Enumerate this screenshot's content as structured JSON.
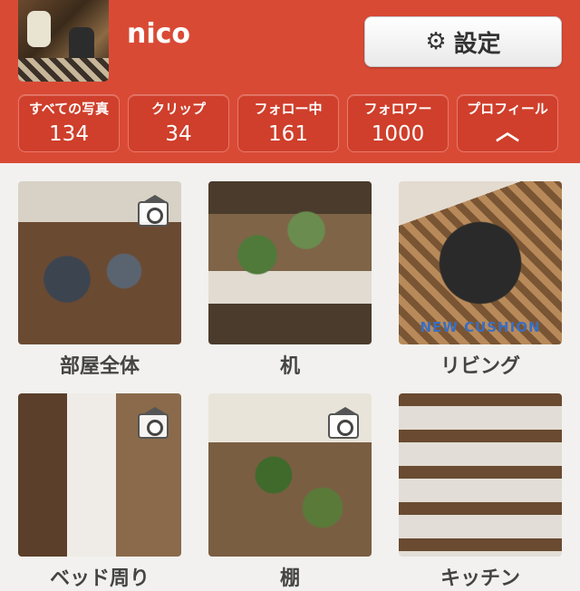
{
  "header": {
    "username": "nico",
    "settings_label": "設定",
    "settings_icon": "gear-icon",
    "accent_color": "#d94a35"
  },
  "stats": [
    {
      "label": "すべての写真",
      "value": "134"
    },
    {
      "label": "クリップ",
      "value": "34"
    },
    {
      "label": "フォロー中",
      "value": "161"
    },
    {
      "label": "フォロワー",
      "value": "1000"
    },
    {
      "label": "プロフィール",
      "icon": "chevron-up-icon"
    }
  ],
  "albums": [
    {
      "caption": "部屋全体",
      "camera": true
    },
    {
      "caption": "机",
      "camera": false
    },
    {
      "caption": "リビング",
      "camera": false,
      "overlay": "NEW CUSHION"
    },
    {
      "caption": "ベッド周り",
      "camera": true
    },
    {
      "caption": "棚",
      "camera": true
    },
    {
      "caption": "キッチン",
      "camera": false
    }
  ]
}
